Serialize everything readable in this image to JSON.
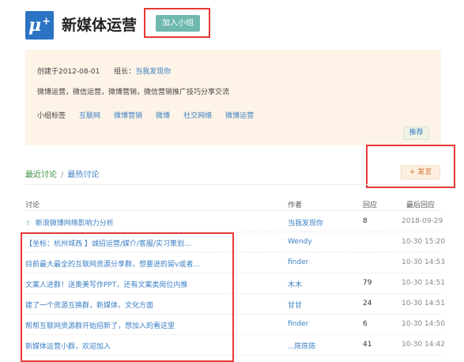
{
  "group": {
    "title": "新媒体运营",
    "join_label": "加入小组",
    "logo_text": "μ",
    "logo_plus": "+"
  },
  "info": {
    "created_label": "创建于2012-08-01",
    "owner_prefix": "组长：",
    "owner_name": "当我发现你",
    "description": "微博运营，微信运营，微博营销，微信营销推广技巧分享交流",
    "tags_label": "小组标签",
    "tags": [
      "互联网",
      "微博营销",
      "微博",
      "社交网络",
      "微博运营"
    ],
    "recommend_label": "推荐"
  },
  "tabs": {
    "recent": "最近讨论",
    "separator": "/",
    "hot": "最热讨论",
    "post_label": "+ 发言"
  },
  "table": {
    "headers": {
      "topic": "讨论",
      "author": "作者",
      "replies": "回应",
      "last_reply": "最后回应"
    },
    "rows": [
      {
        "topic": "新浪微博网络影响力分析",
        "author": "当我发现你",
        "replies": "8",
        "time": "2018-09-29",
        "pinned": true
      },
      {
        "topic": "【坐标：杭州城西 】诚招运营/媒介/客服/实习策划...",
        "author": "Wendy",
        "replies": "",
        "time": "10-30 15:20"
      },
      {
        "topic": "目前最大最全的互联网资源分享群，想要进的留v或者...",
        "author": "finder",
        "replies": "",
        "time": "10-30 14:53"
      },
      {
        "topic": "文案人进群！送奥美写作PPT，还有文案类岗位内推",
        "author": "木木",
        "replies": "79",
        "time": "10-30 14:51"
      },
      {
        "topic": "建了一个资源互换群，新媒体，文化方面",
        "author": "甘甘",
        "replies": "24",
        "time": "10-30 14:51"
      },
      {
        "topic": "帮帮互联网资源群开始招新了，想加入的看这里",
        "author": "finder",
        "replies": "6",
        "time": "10-30 14:50"
      },
      {
        "topic": "新媒体运营小群，欢迎加入",
        "author": "...陈陈陈",
        "replies": "41",
        "time": "10-30 14:42"
      }
    ]
  },
  "colors": {
    "accent_green": "#6fb8ae",
    "link_blue": "#3b7fc4",
    "highlight_red": "#e53935",
    "panel_bg": "#fdf3e7"
  }
}
